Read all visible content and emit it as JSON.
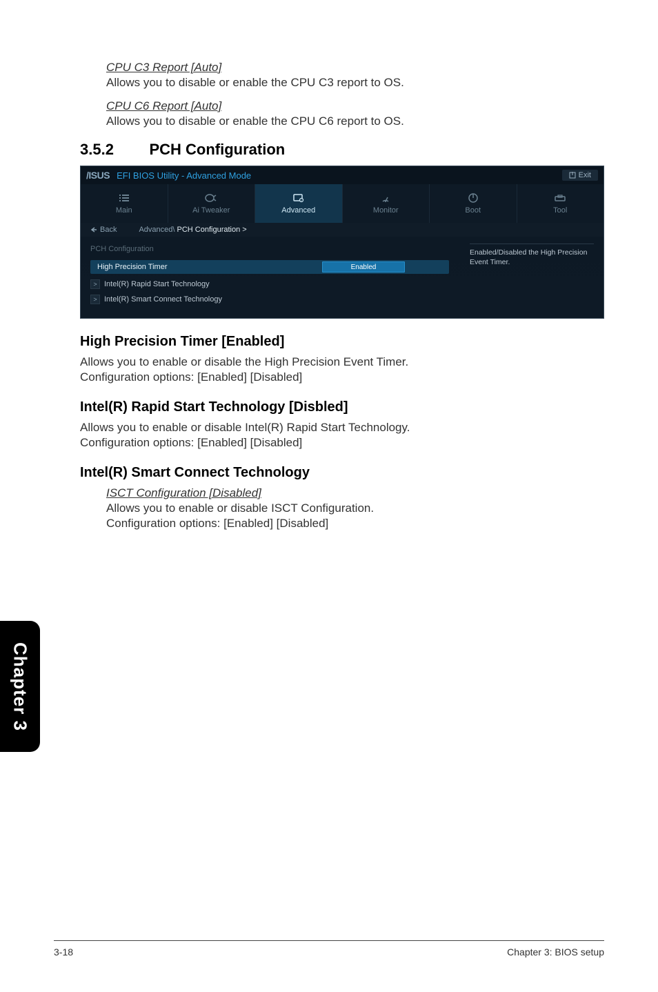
{
  "cpu_c3": {
    "title": "CPU C3 Report [Auto]",
    "desc": "Allows you to disable or enable the CPU C3 report to OS."
  },
  "cpu_c6": {
    "title": "CPU C6 Report [Auto]",
    "desc": "Allows you to disable or enable the CPU C6 report to OS."
  },
  "section": {
    "num": "3.5.2",
    "title": "PCH Configuration"
  },
  "bios": {
    "brand": "/ISUS",
    "mode": "EFI BIOS Utility - Advanced Mode",
    "exit": "Exit",
    "tabs": {
      "main": "Main",
      "tweaker": "Ai Tweaker",
      "advanced": "Advanced",
      "monitor": "Monitor",
      "boot": "Boot",
      "tool": "Tool"
    },
    "back": "Back",
    "crumb_prefix": "Advanced\\",
    "crumb_current": " PCH Configuration  >",
    "panel_title": "PCH Configuration",
    "hp_label": "High Precision Timer",
    "hp_value": "Enabled",
    "sub1": "Intel(R) Rapid Start Technology",
    "sub2": "Intel(R) Smart Connect Technology",
    "help": "Enabled/Disabled the High Precision Event Timer."
  },
  "hp_timer": {
    "title": "High Precision Timer [Enabled]",
    "line1": "Allows you to enable or disable the High Precision Event Timer.",
    "line2": "Configuration options: [Enabled] [Disabled]"
  },
  "rapid": {
    "title": "Intel(R) Rapid Start Technology [Disbled]",
    "line1": "Allows you to enable or disable Intel(R) Rapid Start Technology.",
    "line2": "Configuration options: [Enabled] [Disabled]"
  },
  "smart": {
    "title": "Intel(R) Smart Connect Technology",
    "sub_title": "ISCT Configuration [Disabled]",
    "line1": "Allows you to enable or disable ISCT Configuration.",
    "line2": "Configuration options: [Enabled] [Disabled]"
  },
  "sidebar": "Chapter 3",
  "footer": {
    "left": "3-18",
    "right": "Chapter 3: BIOS setup"
  }
}
